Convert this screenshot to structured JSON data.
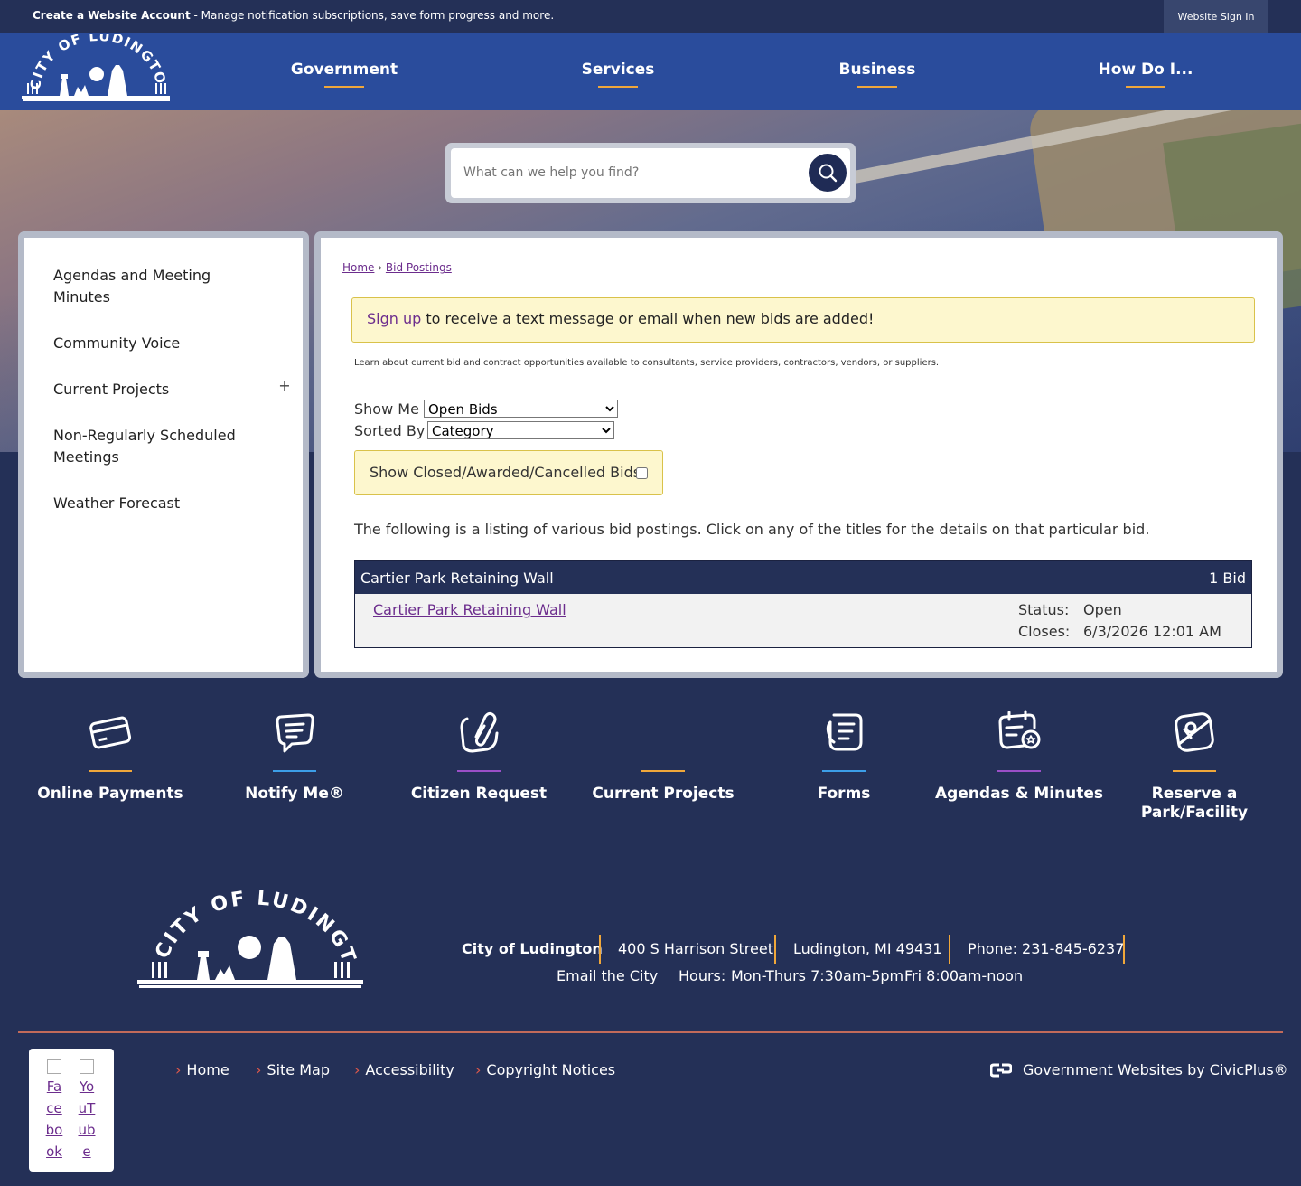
{
  "topbar": {
    "create_bold": "Create a Website Account",
    "create_rest": " - Manage notification subscriptions, save form progress and more.",
    "signin": "Website Sign In"
  },
  "header": {
    "logo_alt": "City of Ludington",
    "nav": [
      "Government",
      "Services",
      "Business",
      "How Do I..."
    ]
  },
  "search": {
    "placeholder": "What can we help you find?"
  },
  "sidebar": {
    "items": [
      {
        "label": "Agendas and Meeting Minutes"
      },
      {
        "label": "Community Voice"
      },
      {
        "label": "Current Projects",
        "expand": "+"
      },
      {
        "label": "Non-Regularly Scheduled Meetings"
      },
      {
        "label": "Weather Forecast"
      }
    ]
  },
  "breadcrumb": {
    "home": "Home",
    "sep": "›",
    "current": "Bid Postings"
  },
  "alert": {
    "link": "Sign up",
    "text": " to receive a text message or email when new bids are added!"
  },
  "intro": "Learn about current bid and contract opportunities available to consultants, service providers, contractors, vendors, or suppliers.",
  "filters": {
    "show_me_label": "Show Me",
    "show_me_value": "Open Bids",
    "sorted_by_label": "Sorted By",
    "sorted_by_value": "Category",
    "closed_label": "Show Closed/Awarded/Cancelled Bids:"
  },
  "listing_text": "The following is a listing of various bid postings. Click on any of the titles for the details on that particular bid.",
  "bid_group": {
    "title": "Cartier Park Retaining Wall",
    "count": "1 Bid",
    "bids": [
      {
        "title": "Cartier Park Retaining Wall",
        "status_label": "Status:",
        "status": "Open",
        "closes_label": "Closes:",
        "closes": "6/3/2026 12:01 AM"
      }
    ]
  },
  "quick_links": [
    {
      "label": "Online Payments",
      "icon": "credit-card-icon",
      "color": "#f0a73a"
    },
    {
      "label": "Notify Me®",
      "icon": "chat-bubble-icon",
      "color": "#3c9ee8"
    },
    {
      "label": "Citizen Request",
      "icon": "paperclip-icon",
      "color": "#9b4fc7"
    },
    {
      "label": "Current Projects",
      "icon": "",
      "color": "#f0a73a"
    },
    {
      "label": "Forms",
      "icon": "form-icon",
      "color": "#3c9ee8"
    },
    {
      "label": "Agendas & Minutes",
      "icon": "calendar-list-icon",
      "color": "#9b4fc7"
    },
    {
      "label": "Reserve a Park/Facility",
      "icon": "map-pin-icon",
      "color": "#f0a73a"
    }
  ],
  "footer": {
    "name": "City of Ludington",
    "address": "400 S Harrison Street",
    "city": "Ludington, MI 49431",
    "phone": "Phone: 231-845-6237",
    "email": "Email the City",
    "hours_label": "Hours:",
    "hours1": "Mon-Thurs 7:30am-5pm",
    "hours2": "Fri 8:00am-noon",
    "links": [
      "Home",
      "Site Map",
      "Accessibility",
      "Copyright Notices"
    ],
    "civic": "Government Websites by CivicPlus®",
    "social": [
      {
        "lines": [
          "Fa",
          "ce",
          "bo",
          "ok"
        ]
      },
      {
        "lines": [
          "Yo",
          "uT",
          "ub",
          "e"
        ]
      }
    ]
  },
  "colors": {
    "navy": "#243057",
    "header_blue": "#2a4c9c",
    "accent_gold": "#f0a73a",
    "link_purple": "#6c2d8d"
  }
}
